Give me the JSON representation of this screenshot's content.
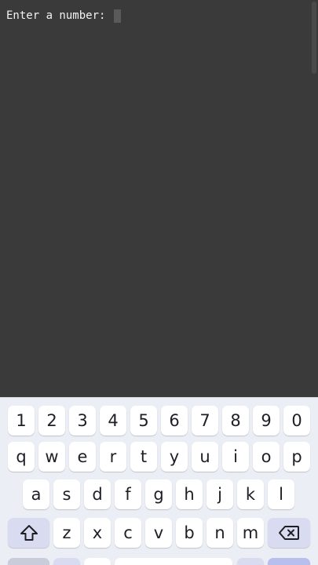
{
  "terminal": {
    "prompt": "Enter a number: "
  },
  "keyboard": {
    "number_row": [
      "1",
      "2",
      "3",
      "4",
      "5",
      "6",
      "7",
      "8",
      "9",
      "0"
    ],
    "row1": [
      "q",
      "w",
      "e",
      "r",
      "t",
      "y",
      "u",
      "i",
      "o",
      "p"
    ],
    "row2": [
      "a",
      "s",
      "d",
      "f",
      "g",
      "h",
      "j",
      "k",
      "l"
    ],
    "row3": [
      "z",
      "x",
      "c",
      "v",
      "b",
      "n",
      "m"
    ],
    "shift_icon": "shift-arrow-icon",
    "backspace_icon": "backspace-icon"
  },
  "colors": {
    "terminal_bg": "#3a3a3a",
    "keyboard_bg": "#eceef6",
    "key_bg": "#ffffff",
    "special_key_bg": "#d9dcf0"
  }
}
